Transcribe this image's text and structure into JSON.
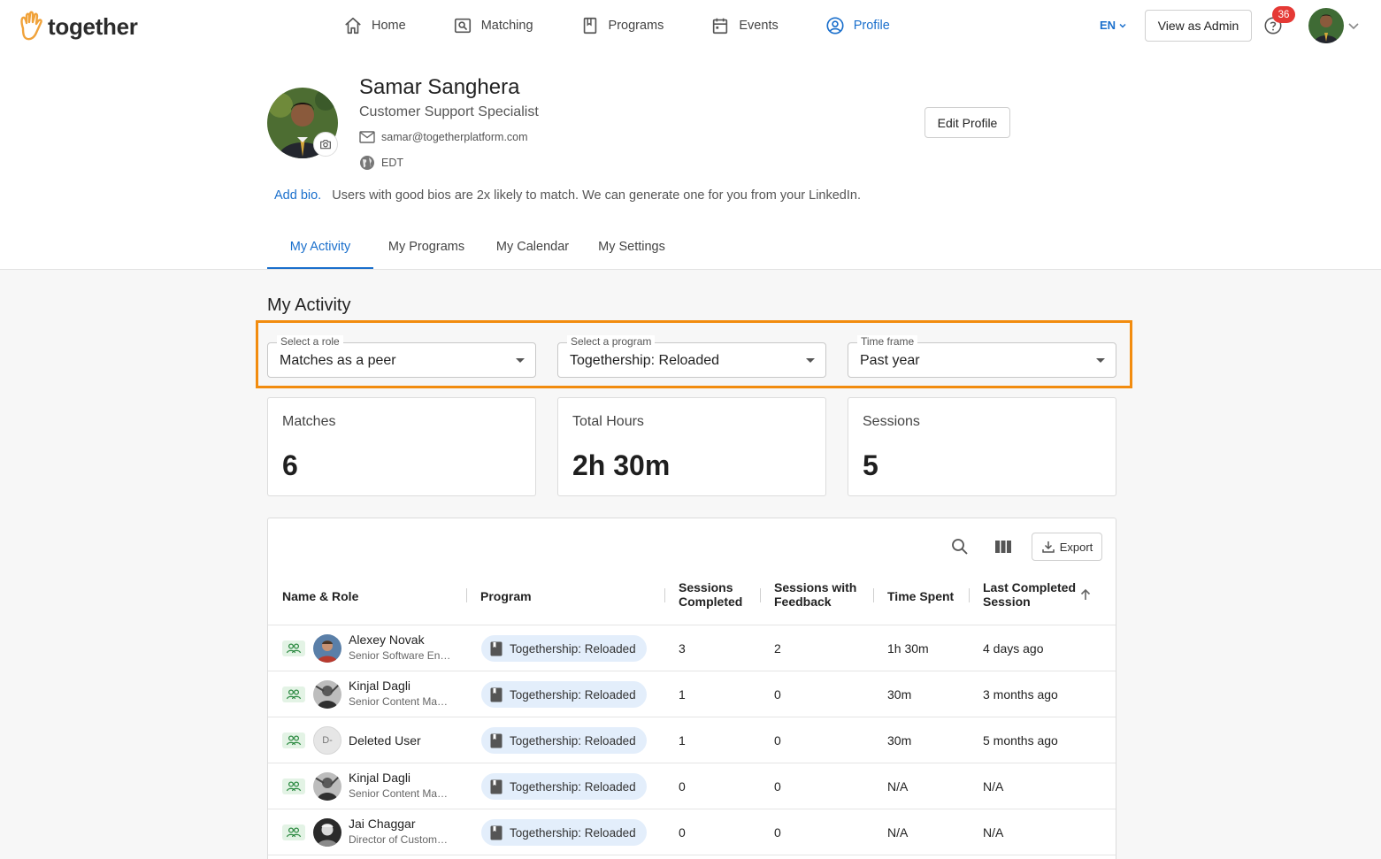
{
  "brand": {
    "name": "together",
    "accent": "#1a6fcc",
    "highlight": "#f28c0f"
  },
  "nav": [
    {
      "label": "Home",
      "icon": "home-icon"
    },
    {
      "label": "Matching",
      "icon": "matching-icon"
    },
    {
      "label": "Programs",
      "icon": "programs-icon"
    },
    {
      "label": "Events",
      "icon": "calendar-icon"
    },
    {
      "label": "Profile",
      "icon": "profile-icon",
      "active": true
    }
  ],
  "header": {
    "lang": "EN",
    "admin_label": "View as Admin",
    "notifications": "36"
  },
  "profile": {
    "name": "Samar Sanghera",
    "title": "Customer Support Specialist",
    "email": "samar@togetherplatform.com",
    "timezone": "EDT",
    "edit_label": "Edit Profile",
    "bio_link": "Add bio.",
    "bio_hint": "Users with good bios are 2x likely to match. We can generate one for you from your LinkedIn."
  },
  "tabs": [
    {
      "label": "My Activity",
      "active": true
    },
    {
      "label": "My Programs"
    },
    {
      "label": "My Calendar"
    },
    {
      "label": "My Settings"
    }
  ],
  "activity": {
    "title": "My Activity",
    "filters": [
      {
        "label": "Select a role",
        "value": "Matches as a peer"
      },
      {
        "label": "Select a program",
        "value": "Togethership: Reloaded"
      },
      {
        "label": "Time frame",
        "value": "Past year"
      }
    ],
    "stats": [
      {
        "label": "Matches",
        "value": "6"
      },
      {
        "label": "Total Hours",
        "value": "2h 30m"
      },
      {
        "label": "Sessions",
        "value": "5"
      }
    ]
  },
  "table": {
    "export_label": "Export",
    "columns": {
      "name": "Name & Role",
      "program": "Program",
      "sessions": [
        "Sessions",
        "Completed"
      ],
      "feedback": [
        "Sessions with",
        "Feedback"
      ],
      "time": "Time Spent",
      "last": [
        "Last Completed",
        "Session"
      ]
    },
    "rows": [
      {
        "name": "Alexey Novak",
        "role": "Senior Software En…",
        "program": "Togethership: Reloaded",
        "sessions": "3",
        "feedback": "2",
        "time": "1h 30m",
        "last": "4 days ago"
      },
      {
        "name": "Kinjal Dagli",
        "role": "Senior Content Ma…",
        "program": "Togethership: Reloaded",
        "sessions": "1",
        "feedback": "0",
        "time": "30m",
        "last": "3 months ago"
      },
      {
        "name": "Deleted User",
        "initials": "D-",
        "program": "Togethership: Reloaded",
        "sessions": "1",
        "feedback": "0",
        "time": "30m",
        "last": "5 months ago"
      },
      {
        "name": "Kinjal Dagli",
        "role": "Senior Content Ma…",
        "program": "Togethership: Reloaded",
        "sessions": "0",
        "feedback": "0",
        "time": "N/A",
        "last": "N/A"
      },
      {
        "name": "Jai Chaggar",
        "role": "Director of Custom…",
        "program": "Togethership: Reloaded",
        "sessions": "0",
        "feedback": "0",
        "time": "N/A",
        "last": "N/A"
      }
    ]
  }
}
